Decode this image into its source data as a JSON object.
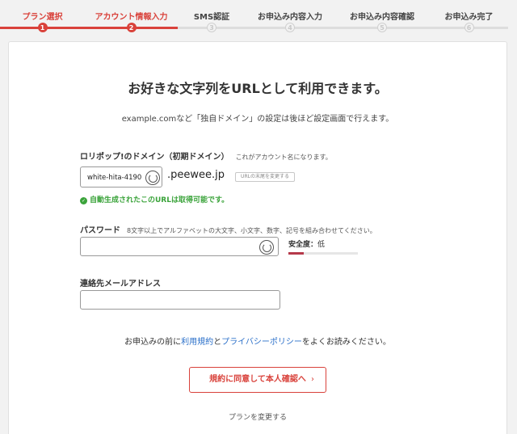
{
  "stepper": {
    "steps": [
      {
        "label": "プラン選択",
        "num": "1"
      },
      {
        "label": "アカウント情報入力",
        "num": "2"
      },
      {
        "label": "SMS認証",
        "num": "3"
      },
      {
        "label": "お申込み内容入力",
        "num": "4"
      },
      {
        "label": "お申込み内容確認",
        "num": "5"
      },
      {
        "label": "お申込み完了",
        "num": "6"
      }
    ],
    "current_step": 2
  },
  "form": {
    "title": "お好きな文字列をURLとして利用できます。",
    "subtitle": "example.comなど「独自ドメイン」の設定は後ほど設定画面で行えます。",
    "domain": {
      "label": "ロリポップ!のドメイン（初期ドメイン）",
      "note": "これがアカウント名になります。",
      "value": "white-hita-4190",
      "suffix": ".peewee.jp",
      "change_button": "URLの末尾を変更する",
      "availability": "自動生成されたこのURLは取得可能です。"
    },
    "password": {
      "label": "パスワード",
      "note": "8文字以上でアルファベットの大文字、小文字、数字、記号を組み合わせてください。",
      "value": "",
      "strength_label": "安全度：",
      "strength_level": "低",
      "strength_fraction": 0.22
    },
    "email": {
      "label": "連絡先メールアドレス",
      "value": ""
    },
    "terms": {
      "prefix": "お申込みの前に",
      "terms_link": "利用規約",
      "and": "と",
      "privacy_link": "プライバシーポリシー",
      "suffix": "をよくお読みください。"
    },
    "submit_label": "規約に同意して本人確認へ",
    "submit_chevron": "›",
    "change_plan": "プランを変更する"
  },
  "colors": {
    "accent": "#d9423b",
    "link": "#2a6fc9",
    "success": "#3aa33a",
    "strength_low": "#b5394a"
  }
}
